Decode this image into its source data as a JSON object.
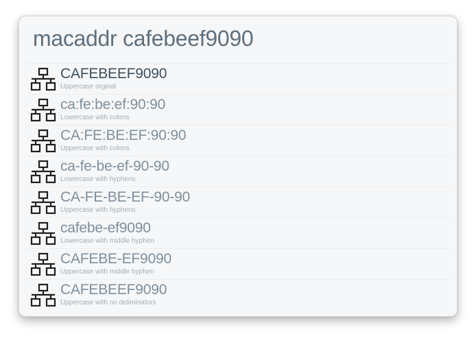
{
  "query": "macaddr cafebeef9090",
  "icon": "network-topology-icon",
  "results": [
    {
      "title": "CAFEBEEF9090",
      "subtitle": "Uppercase orginal",
      "selected": true
    },
    {
      "title": "ca:fe:be:ef:90:90",
      "subtitle": "Lowercase with colons"
    },
    {
      "title": "CA:FE:BE:EF:90:90",
      "subtitle": "Uppercase with colons"
    },
    {
      "title": "ca-fe-be-ef-90-90",
      "subtitle": "Lowercase with hyphens"
    },
    {
      "title": "CA-FE-BE-EF-90-90",
      "subtitle": "Uppercase with hyphens"
    },
    {
      "title": "cafebe-ef9090",
      "subtitle": "Lowercase with middle hyphen"
    },
    {
      "title": "CAFEBE-EF9090",
      "subtitle": "Uppercase with middle hyphen"
    },
    {
      "title": "CAFEBEEF9090",
      "subtitle": "Uppercase with no deliminators"
    }
  ]
}
